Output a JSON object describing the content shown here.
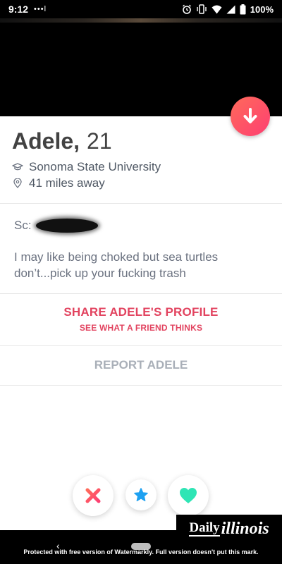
{
  "status_bar": {
    "time": "9:12",
    "dots": "•••l",
    "battery_percent": "100%"
  },
  "profile": {
    "name": "Adele,",
    "age": "21",
    "school": "Sonoma State University",
    "distance": "41 miles away"
  },
  "bio": {
    "sc_label": "Sc:",
    "text": "I may like being choked but sea turtles don’t...pick up your fucking trash"
  },
  "share": {
    "title": "SHARE ADELE'S PROFILE",
    "subtitle": "SEE WHAT A FRIEND THINKS"
  },
  "report": {
    "label": "REPORT ADELE"
  },
  "colors": {
    "brand_gradient_start": "#ff6a5a",
    "brand_gradient_end": "#fd3f72",
    "nope": "#ff4458",
    "super_like": "#1ea1f1",
    "like": "#2ee5b5",
    "share_text": "#e2435f",
    "report_text": "#a9afb8"
  },
  "nav": {
    "back_glyph": "‹"
  },
  "watermark": {
    "brand_daily": "Daily",
    "brand_illinois": "illinois",
    "note": "Protected with free version of Watermarkly. Full version doesn't put this mark."
  }
}
